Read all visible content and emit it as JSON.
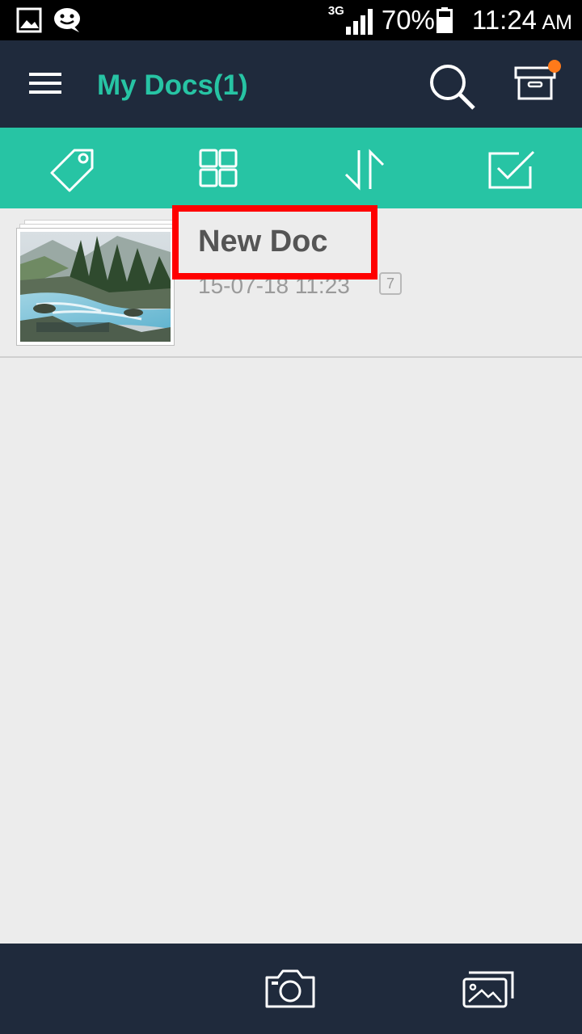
{
  "status_bar": {
    "network": "3G",
    "battery": "70%",
    "time": "11:24",
    "ampm": "AM",
    "icons": [
      "image-icon",
      "chat-icon",
      "signal-icon",
      "battery-icon"
    ]
  },
  "app_bar": {
    "title": "My Docs(1)",
    "icons": [
      "menu-icon",
      "search-icon",
      "archive-icon"
    ],
    "accent": "#27c4a4",
    "notification_color": "#ff7a1a"
  },
  "toolbar": {
    "icons": [
      "tag-icon",
      "grid-view-icon",
      "sort-icon",
      "select-icon"
    ]
  },
  "documents": [
    {
      "name": "New Doc",
      "date": "15-07-18 11:23",
      "pages": "7"
    }
  ],
  "bottom_bar": {
    "icons": [
      "camera-icon",
      "import-image-icon"
    ]
  },
  "colors": {
    "appbar": "#1f2a3c",
    "toolbar": "#27c4a4",
    "background": "#ececec",
    "highlight": "#ff0000"
  }
}
